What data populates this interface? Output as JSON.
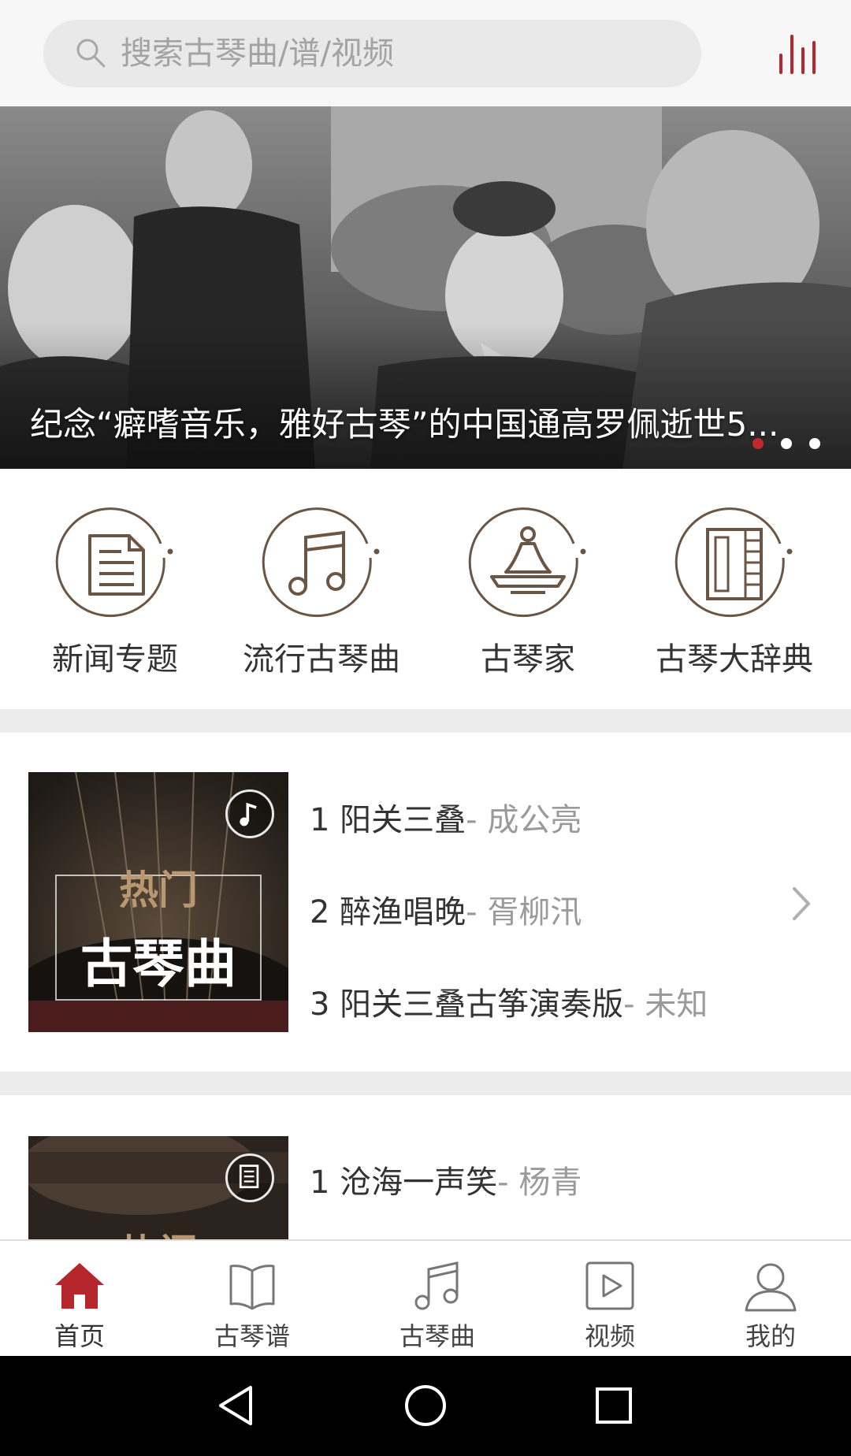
{
  "search": {
    "placeholder": "搜索古琴曲/谱/视频"
  },
  "banner": {
    "caption": "纪念“癖嗜音乐，雅好古琴”的中国通高罗佩逝世5...",
    "dot_count": 3,
    "active_dot": 0,
    "active_color": "#c0282d"
  },
  "categories": [
    {
      "label": "新闻专题",
      "icon": "news-document-icon"
    },
    {
      "label": "流行古琴曲",
      "icon": "music-note-icon"
    },
    {
      "label": "古琴家",
      "icon": "guqin-master-icon"
    },
    {
      "label": "古琴大辞典",
      "icon": "dictionary-book-icon"
    }
  ],
  "hot_songs": {
    "thumb_title": "热门",
    "thumb_subtitle": "古琴曲",
    "items": [
      {
        "index": "1",
        "title": "阳关三叠",
        "artist": "- 成公亮"
      },
      {
        "index": "2",
        "title": "醉渔唱晚",
        "artist": "- 胥柳汛"
      },
      {
        "index": "3",
        "title": "阳关三叠古筝演奏版",
        "artist": "- 未知"
      }
    ]
  },
  "hot_scores": {
    "thumb_title": "热门",
    "items": [
      {
        "index": "1",
        "title": "沧海一声笑",
        "artist": "- 杨青"
      }
    ]
  },
  "tabs": [
    {
      "label": "首页",
      "icon": "home-icon",
      "active": true
    },
    {
      "label": "古琴谱",
      "icon": "open-book-icon",
      "active": false
    },
    {
      "label": "古琴曲",
      "icon": "music-note-icon",
      "active": false
    },
    {
      "label": "视频",
      "icon": "video-play-icon",
      "active": false
    },
    {
      "label": "我的",
      "icon": "user-icon",
      "active": false
    }
  ],
  "colors": {
    "accent": "#b5272d",
    "icon_brown": "#6b5544",
    "divider": "#ececec"
  }
}
